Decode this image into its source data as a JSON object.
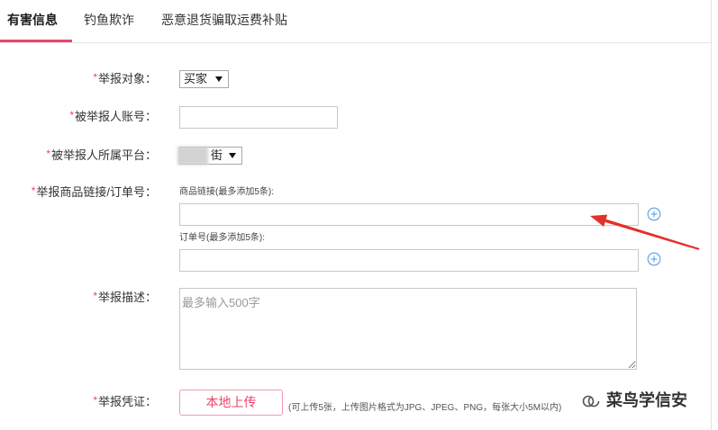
{
  "tabs": [
    {
      "label": "有害信息"
    },
    {
      "label": "钓鱼欺诈"
    },
    {
      "label": "恶意退货骗取运费补贴"
    }
  ],
  "active_tab_index": 0,
  "colors": {
    "accent": "#e8456a",
    "required_mark": "#ee4466",
    "plus_icon": "#5b9fe0",
    "annotation_arrow": "#e5302a"
  },
  "icons": {
    "dropdown": "dropdown-arrow-icon",
    "add_row": "plus-circle-icon",
    "watermark": "wechat-icon"
  },
  "form": {
    "required_mark": "*",
    "report_target": {
      "label": "举报对象：",
      "value": "买家"
    },
    "reported_account": {
      "label": "被举报人账号："
    },
    "platform": {
      "label": "被举报人所属平台：",
      "value": "街"
    },
    "links": {
      "label": "举报商品链接/订单号：",
      "product_link_hint": "商品链接(最多添加5条):",
      "order_no_hint": "订单号(最多添加5条):"
    },
    "description": {
      "label": "举报描述：",
      "placeholder": "最多输入500字"
    },
    "evidence": {
      "label": "举报凭证：",
      "upload_button": "本地上传",
      "note": "(可上传5张，上传图片格式为JPG、JPEG、PNG，每张大小5M以内)"
    }
  },
  "watermark": {
    "text": "菜鸟学信安"
  }
}
